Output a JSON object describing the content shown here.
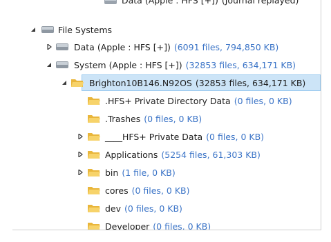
{
  "tree": {
    "partial_top": {
      "label": "Data (Apple : HFS [+])",
      "count": "(Journal replayed)"
    },
    "file_systems": {
      "label": "File Systems"
    },
    "data_volume": {
      "label": "Data (Apple : HFS [+])",
      "count": "(6091 files, 794,850 KB)"
    },
    "system_volume": {
      "label": "System (Apple : HFS [+])",
      "count": "(32853 files, 634,171 KB)"
    },
    "brighton": {
      "label": "Brighton10B146.N92OS",
      "count": "(32853 files, 634,171 KB)"
    },
    "folders": [
      {
        "label": ".HFS+ Private Directory Data",
        "count": "(0 files, 0 KB)"
      },
      {
        "label": ".Trashes",
        "count": "(0 files, 0 KB)"
      },
      {
        "label": "____HFS+ Private Data",
        "count": "(0 files, 0 KB)"
      },
      {
        "label": "Applications",
        "count": "(5254 files, 61,303 KB)"
      },
      {
        "label": "bin",
        "count": "(1 file, 0 KB)"
      },
      {
        "label": "cores",
        "count": "(0 files, 0 KB)"
      },
      {
        "label": "dev",
        "count": "(0 files, 0 KB)"
      },
      {
        "label": "Developer",
        "count": "(0 files, 0 KB)"
      }
    ]
  },
  "colors": {
    "count_text": "#3b74c7",
    "selection_bg": "#cce4f7",
    "folder": "#f3c74f"
  }
}
